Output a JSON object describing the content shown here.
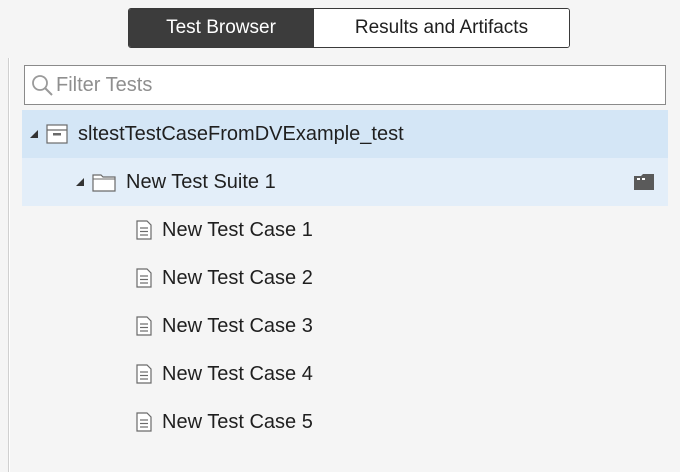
{
  "tabs": {
    "test_browser": "Test Browser",
    "results_and_artifacts": "Results and Artifacts"
  },
  "filter": {
    "placeholder": "Filter Tests"
  },
  "tree": {
    "file": {
      "label": "sltestTestCaseFromDVExample_test",
      "icon": "test-file-icon"
    },
    "suite": {
      "label": "New Test Suite 1",
      "icon": "folder-icon"
    },
    "cases": [
      {
        "label": "New Test Case 1",
        "icon": "test-case-icon"
      },
      {
        "label": "New Test Case 2",
        "icon": "test-case-icon"
      },
      {
        "label": "New Test Case 3",
        "icon": "test-case-icon"
      },
      {
        "label": "New Test Case 4",
        "icon": "test-case-icon"
      },
      {
        "label": "New Test Case 5",
        "icon": "test-case-icon"
      }
    ]
  },
  "colors": {
    "active_tab_bg": "#3c3c3c",
    "selected_file_row": "#d4e6f6",
    "selected_suite_row": "#e3eef9",
    "panel_bg": "#f5f5f5"
  }
}
